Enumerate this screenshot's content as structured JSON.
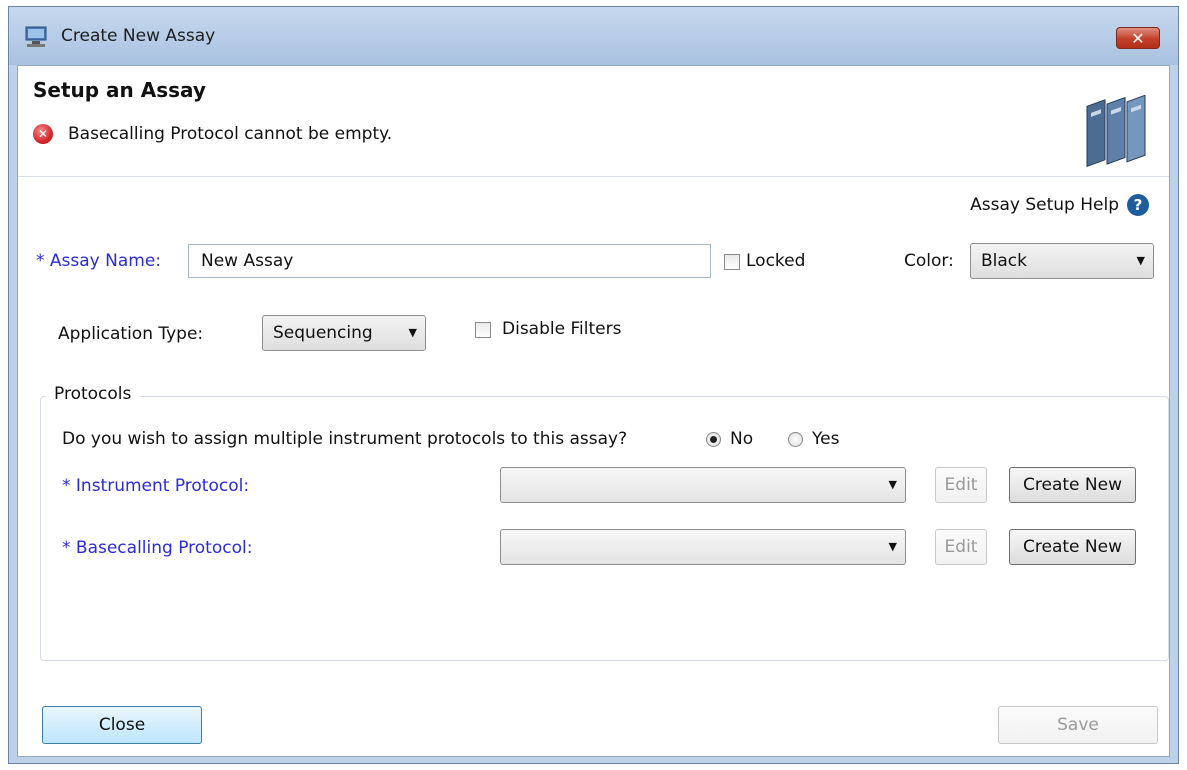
{
  "window": {
    "title": "Create New Assay",
    "close_glyph": "✕"
  },
  "header": {
    "title": "Setup an Assay",
    "error_message": "Basecalling Protocol cannot be empty."
  },
  "help": {
    "label": "Assay Setup Help",
    "glyph": "?"
  },
  "form": {
    "assay_name_label": "* Assay Name:",
    "assay_name_value": "New Assay",
    "locked_label": "Locked",
    "locked_checked": false,
    "color_label": "Color:",
    "color_value": "Black",
    "application_type_label": "Application Type:",
    "application_type_value": "Sequencing",
    "disable_filters_label": "Disable Filters",
    "disable_filters_checked": false
  },
  "protocols": {
    "legend": "Protocols",
    "question": "Do you wish to assign multiple instrument protocols to this assay?",
    "option_no": "No",
    "option_yes": "Yes",
    "selected": "No",
    "instrument_label": "* Instrument Protocol:",
    "instrument_value": "",
    "basecalling_label": "* Basecalling Protocol:",
    "basecalling_value": "",
    "edit_label": "Edit",
    "create_new_label": "Create New"
  },
  "footer": {
    "close_label": "Close",
    "save_label": "Save"
  },
  "colors": {
    "required_label": "#2b2bd8",
    "error": "#d4282d",
    "help_icon": "#1d5d9e"
  }
}
